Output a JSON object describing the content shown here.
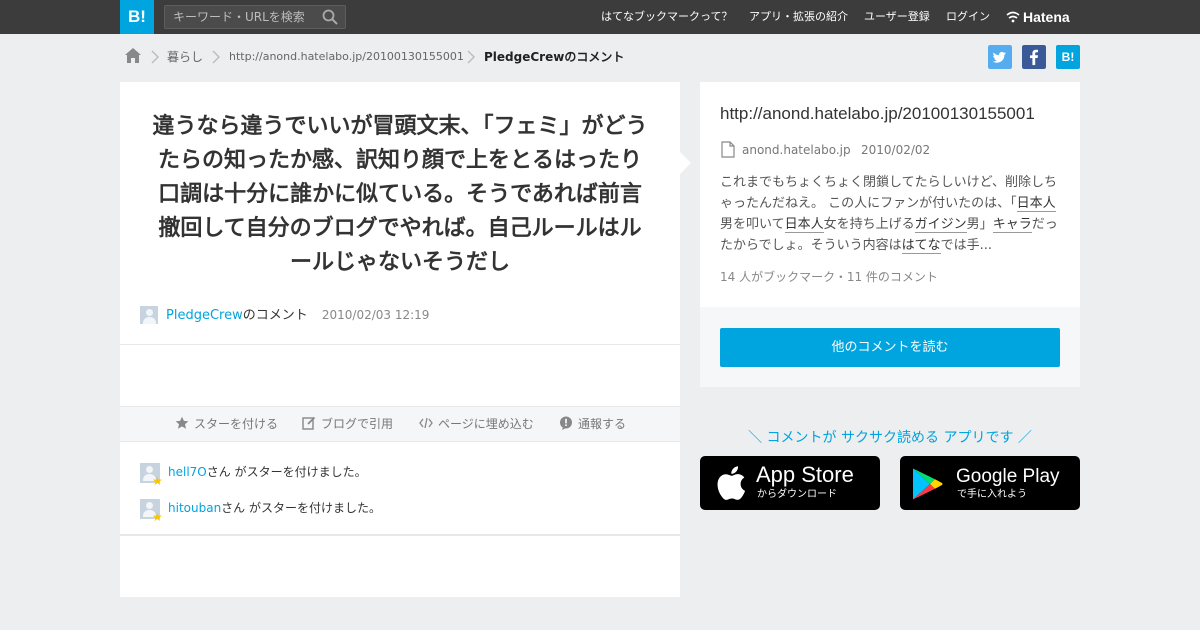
{
  "header": {
    "logo": "B!",
    "search_placeholder": "キーワード・URLを検索",
    "nav": [
      "はてなブックマークって？",
      "アプリ・拡張の紹介",
      "ユーザー登録",
      "ログイン"
    ],
    "hatena": "Hatena"
  },
  "breadcrumb": {
    "items": [
      "暮らし",
      "http://anond.hatelabo.jp/20100130155001",
      "PledgeCrewのコメント"
    ]
  },
  "share": {
    "twitter": "twitter-icon",
    "facebook": "facebook-icon",
    "hatebu_label": "B!"
  },
  "comment": {
    "text": "違うなら違うでいいが冒頭文末、「フェミ」がどうたらの知ったか感、訳知り顔で上をとるはったり口調は十分に誰かに似ている。そうであれば前言撤回して自分のブログでやれば。自己ルールはルールじゃないそうだし",
    "user": "PledgeCrew",
    "user_suffix": "のコメント",
    "date": "2010/02/03 12:19"
  },
  "actions": [
    "スターを付ける",
    "ブログで引用",
    "ページに埋め込む",
    "通報する"
  ],
  "stars": [
    {
      "user": "hell7O",
      "text": "さん がスターを付けました。"
    },
    {
      "user": "hitouban",
      "text": "さん がスターを付けました。"
    }
  ],
  "entry": {
    "title": "http://anond.hatelabo.jp/20100130155001",
    "domain": "anond.hatelabo.jp",
    "date": "2010/02/02",
    "excerpt": {
      "p1": "これまでもちょくちょく閉鎖してたらしいけど、削除しちゃったんだねえ。 この人にファンが付いたのは、「",
      "k1": "日本人",
      "p2": "男を叩いて",
      "k2": "日本人",
      "p3": "女を持ち上げる",
      "k3": "ガイジン",
      "p4": "男」",
      "k4": "キャラ",
      "p5": "だったからでしょ。そういう内容は",
      "k5": "はてな",
      "p6": "では手..."
    },
    "counts": "14 人がブックマーク・11 件のコメント",
    "read_button": "他のコメントを読む"
  },
  "promo": {
    "text": "＼ コメントが サクサク読める アプリです ／",
    "appstore_big": "App Store",
    "appstore_small": "からダウンロード",
    "googleplay_big": "Google Play",
    "googleplay_small": "で手に入れよう"
  },
  "colors": {
    "accent": "#00a4de",
    "header_bg": "#3c3c3c",
    "page_bg": "#eceeef",
    "star": "#f6c700",
    "twitter": "#55acee",
    "facebook": "#3b5998"
  }
}
